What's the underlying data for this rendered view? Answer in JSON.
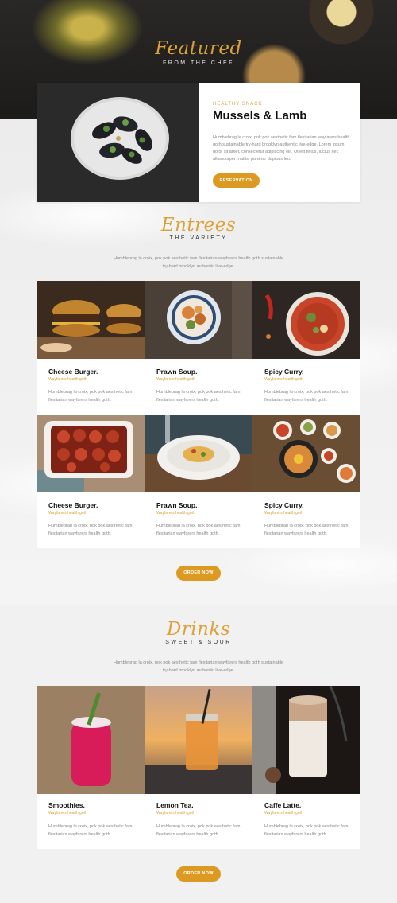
{
  "featured": {
    "script_title": "Featured",
    "subtitle": "FROM THE CHEF",
    "kicker": "HEALTHY SNACK",
    "title": "Mussels & Lamb",
    "description": "Humblebrag la croix, pok pok aesthetic fam flexitarian wayfarers health goth sustainable try-hard brooklyn authentic live-edge. Lorem ipsum dolor sit amet, consectetur adipiscing elit. Ut elit tellus, luctus nec ullamcorper mattis, pulvinar dapibus leo.",
    "button": "RESERVATION"
  },
  "entrees": {
    "script_title": "Entrees",
    "subtitle": "THE VARIETY",
    "intro": "Humblebrag la croix, pok pok aesthetic fam flexitarian wayfarers health goth sustainable try-hard brooklyn authentic live-edge.",
    "items": [
      {
        "name": "Cheese Burger.",
        "tag": "Wayfarers health goth",
        "desc": "Humblebrag la croix, pok pok aesthetic fam flexitarian wayfarers health goth."
      },
      {
        "name": "Prawn Soup.",
        "tag": "Wayfarers health goth",
        "desc": "Humblebrag la croix, pok pok aesthetic fam flexitarian wayfarers health goth."
      },
      {
        "name": "Spicy Curry.",
        "tag": "Wayfarers health goth",
        "desc": "Humblebrag la croix, pok pok aesthetic fam flexitarian wayfarers health goth."
      },
      {
        "name": "Cheese Burger.",
        "tag": "Wayfarers health goth",
        "desc": "Humblebrag la croix, pok pok aesthetic fam flexitarian wayfarers health goth."
      },
      {
        "name": "Prawn Soup.",
        "tag": "Wayfarers health goth",
        "desc": "Humblebrag la croix, pok pok aesthetic fam flexitarian wayfarers health goth."
      },
      {
        "name": "Spicy Curry.",
        "tag": "Wayfarers health goth",
        "desc": "Humblebrag la croix, pok pok aesthetic fam flexitarian wayfarers health goth."
      }
    ],
    "button": "ORDER NOW"
  },
  "drinks": {
    "script_title": "Drinks",
    "subtitle": "SWEET & SOUR",
    "intro": "Humblebrag la croix, pok pok aesthetic fam flexitarian wayfarers health goth sustainable try-hard brooklyn authentic live-edge.",
    "items": [
      {
        "name": "Smoothies.",
        "tag": "Wayfarers health goth",
        "desc": "Humblebrag la croix, pok pok aesthetic fam flexitarian wayfarers health goth."
      },
      {
        "name": "Lemon Tea.",
        "tag": "Wayfarers health goth",
        "desc": "Humblebrag la croix, pok pok aesthetic fam flexitarian wayfarers health goth."
      },
      {
        "name": "Caffe Latte.",
        "tag": "Wayfarers health goth",
        "desc": "Humblebrag la croix, pok pok aesthetic fam flexitarian wayfarers health goth."
      }
    ],
    "button": "ORDER NOW"
  },
  "colors": {
    "accent": "#dca23a",
    "button": "#dc9a22",
    "dark": "#1c1b1a"
  }
}
